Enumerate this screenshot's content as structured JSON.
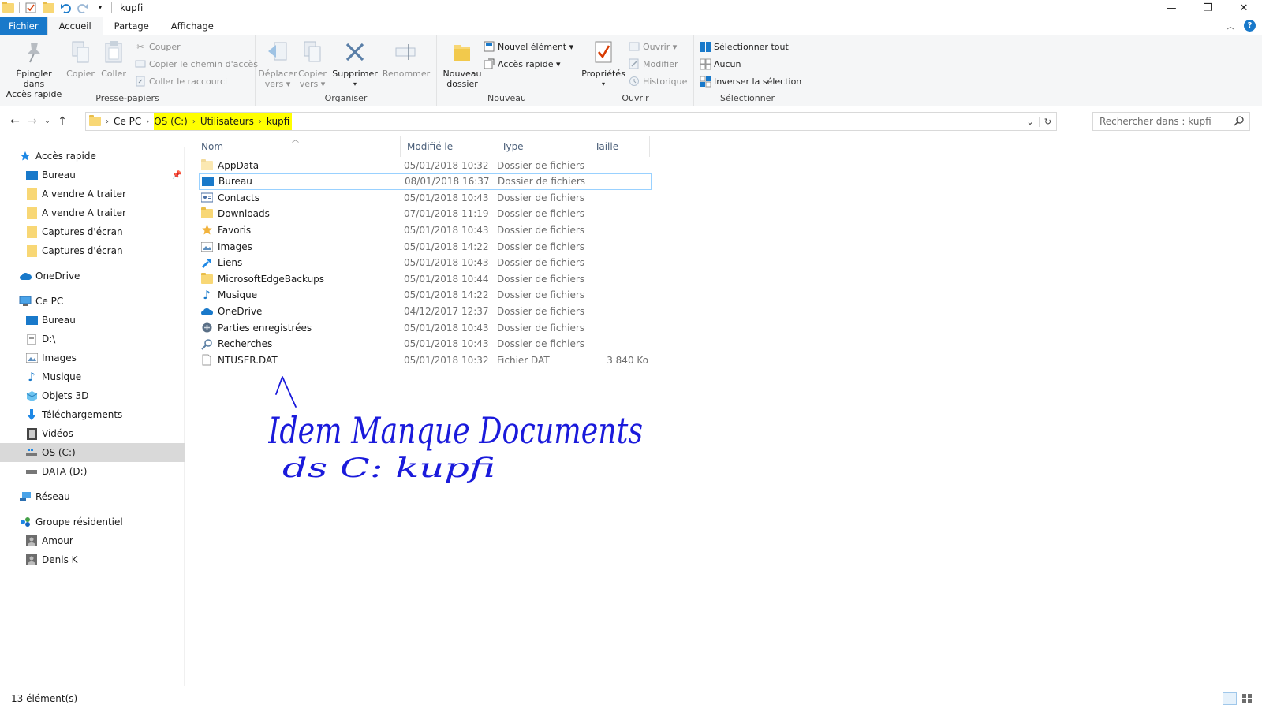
{
  "window": {
    "title": "kupfi",
    "controls": {
      "minimize": "—",
      "maximize": "❐",
      "close": "✕"
    }
  },
  "ribbon_tabs": [
    {
      "label": "Fichier"
    },
    {
      "label": "Accueil"
    },
    {
      "label": "Partage"
    },
    {
      "label": "Affichage"
    }
  ],
  "ribbon": {
    "clipboard": {
      "label": "Presse-papiers",
      "pin_line1": "Épingler dans",
      "pin_line2": "Accès rapide",
      "copy": "Copier",
      "paste": "Coller",
      "cut": "Couper",
      "copy_path": "Copier le chemin d'accès",
      "paste_shortcut": "Coller le raccourci"
    },
    "organize": {
      "label": "Organiser",
      "move_line1": "Déplacer",
      "move_line2": "vers",
      "copyto_line1": "Copier",
      "copyto_line2": "vers",
      "delete": "Supprimer",
      "rename": "Renommer"
    },
    "new": {
      "label": "Nouveau",
      "folder_line1": "Nouveau",
      "folder_line2": "dossier",
      "new_item": "Nouvel élément",
      "easy_access": "Accès rapide"
    },
    "open": {
      "label": "Ouvrir",
      "properties": "Propriétés",
      "open": "Ouvrir",
      "edit": "Modifier",
      "history": "Historique"
    },
    "select": {
      "label": "Sélectionner",
      "select_all": "Sélectionner tout",
      "select_none": "Aucun",
      "invert": "Inverser la sélection"
    }
  },
  "address": {
    "crumbs": [
      "Ce PC",
      "OS (C:)",
      "Utilisateurs",
      "kupfi"
    ],
    "search_placeholder": "Rechercher dans : kupfi"
  },
  "nav": {
    "quick_access": "Accès rapide",
    "quick_items": [
      "Bureau",
      "A vendre A traiter",
      "A vendre A traiter",
      "Captures d'écran",
      "Captures d'écran"
    ],
    "onedrive": "OneDrive",
    "this_pc": "Ce PC",
    "pc_items": [
      "Bureau",
      "D:\\",
      "Images",
      "Musique",
      "Objets 3D",
      "Téléchargements",
      "Vidéos",
      "OS (C:)",
      "DATA (D:)"
    ],
    "network": "Réseau",
    "homegroup": "Groupe résidentiel",
    "homegroup_items": [
      "Amour",
      "Denis K"
    ]
  },
  "columns": {
    "name": "Nom",
    "modified": "Modifié le",
    "type": "Type",
    "size": "Taille"
  },
  "files": [
    {
      "name": "AppData",
      "date": "05/01/2018 10:32",
      "type": "Dossier de fichiers",
      "size": ""
    },
    {
      "name": "Bureau",
      "date": "08/01/2018 16:37",
      "type": "Dossier de fichiers",
      "size": ""
    },
    {
      "name": "Contacts",
      "date": "05/01/2018 10:43",
      "type": "Dossier de fichiers",
      "size": ""
    },
    {
      "name": "Downloads",
      "date": "07/01/2018 11:19",
      "type": "Dossier de fichiers",
      "size": ""
    },
    {
      "name": "Favoris",
      "date": "05/01/2018 10:43",
      "type": "Dossier de fichiers",
      "size": ""
    },
    {
      "name": "Images",
      "date": "05/01/2018 14:22",
      "type": "Dossier de fichiers",
      "size": ""
    },
    {
      "name": "Liens",
      "date": "05/01/2018 10:43",
      "type": "Dossier de fichiers",
      "size": ""
    },
    {
      "name": "MicrosoftEdgeBackups",
      "date": "05/01/2018 10:44",
      "type": "Dossier de fichiers",
      "size": ""
    },
    {
      "name": "Musique",
      "date": "05/01/2018 14:22",
      "type": "Dossier de fichiers",
      "size": ""
    },
    {
      "name": "OneDrive",
      "date": "04/12/2017 12:37",
      "type": "Dossier de fichiers",
      "size": ""
    },
    {
      "name": "Parties enregistrées",
      "date": "05/01/2018 10:43",
      "type": "Dossier de fichiers",
      "size": ""
    },
    {
      "name": "Recherches",
      "date": "05/01/2018 10:43",
      "type": "Dossier de fichiers",
      "size": ""
    },
    {
      "name": "NTUSER.DAT",
      "date": "05/01/2018 10:32",
      "type": "Fichier DAT",
      "size": "3 840 Ko"
    }
  ],
  "status": {
    "count": "13 élément(s)"
  },
  "annotation": {
    "line1": "Idem Manque Documents",
    "line2": "ds C: kupfi",
    "ink_color": "#1a1adb"
  },
  "colors": {
    "accent": "#1979ca",
    "highlight": "#ffff00",
    "ribbon_bg": "#f5f6f7"
  }
}
